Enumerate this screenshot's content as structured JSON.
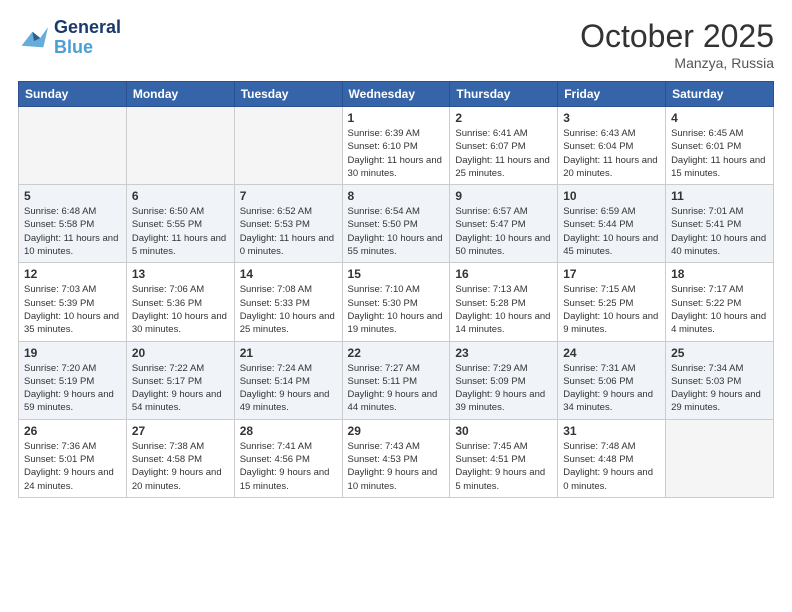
{
  "header": {
    "logo_line1": "General",
    "logo_line2": "Blue",
    "month": "October 2025",
    "location": "Manzya, Russia"
  },
  "weekdays": [
    "Sunday",
    "Monday",
    "Tuesday",
    "Wednesday",
    "Thursday",
    "Friday",
    "Saturday"
  ],
  "weeks": [
    [
      {
        "day": "",
        "info": ""
      },
      {
        "day": "",
        "info": ""
      },
      {
        "day": "",
        "info": ""
      },
      {
        "day": "1",
        "info": "Sunrise: 6:39 AM\nSunset: 6:10 PM\nDaylight: 11 hours\nand 30 minutes."
      },
      {
        "day": "2",
        "info": "Sunrise: 6:41 AM\nSunset: 6:07 PM\nDaylight: 11 hours\nand 25 minutes."
      },
      {
        "day": "3",
        "info": "Sunrise: 6:43 AM\nSunset: 6:04 PM\nDaylight: 11 hours\nand 20 minutes."
      },
      {
        "day": "4",
        "info": "Sunrise: 6:45 AM\nSunset: 6:01 PM\nDaylight: 11 hours\nand 15 minutes."
      }
    ],
    [
      {
        "day": "5",
        "info": "Sunrise: 6:48 AM\nSunset: 5:58 PM\nDaylight: 11 hours\nand 10 minutes."
      },
      {
        "day": "6",
        "info": "Sunrise: 6:50 AM\nSunset: 5:55 PM\nDaylight: 11 hours\nand 5 minutes."
      },
      {
        "day": "7",
        "info": "Sunrise: 6:52 AM\nSunset: 5:53 PM\nDaylight: 11 hours\nand 0 minutes."
      },
      {
        "day": "8",
        "info": "Sunrise: 6:54 AM\nSunset: 5:50 PM\nDaylight: 10 hours\nand 55 minutes."
      },
      {
        "day": "9",
        "info": "Sunrise: 6:57 AM\nSunset: 5:47 PM\nDaylight: 10 hours\nand 50 minutes."
      },
      {
        "day": "10",
        "info": "Sunrise: 6:59 AM\nSunset: 5:44 PM\nDaylight: 10 hours\nand 45 minutes."
      },
      {
        "day": "11",
        "info": "Sunrise: 7:01 AM\nSunset: 5:41 PM\nDaylight: 10 hours\nand 40 minutes."
      }
    ],
    [
      {
        "day": "12",
        "info": "Sunrise: 7:03 AM\nSunset: 5:39 PM\nDaylight: 10 hours\nand 35 minutes."
      },
      {
        "day": "13",
        "info": "Sunrise: 7:06 AM\nSunset: 5:36 PM\nDaylight: 10 hours\nand 30 minutes."
      },
      {
        "day": "14",
        "info": "Sunrise: 7:08 AM\nSunset: 5:33 PM\nDaylight: 10 hours\nand 25 minutes."
      },
      {
        "day": "15",
        "info": "Sunrise: 7:10 AM\nSunset: 5:30 PM\nDaylight: 10 hours\nand 19 minutes."
      },
      {
        "day": "16",
        "info": "Sunrise: 7:13 AM\nSunset: 5:28 PM\nDaylight: 10 hours\nand 14 minutes."
      },
      {
        "day": "17",
        "info": "Sunrise: 7:15 AM\nSunset: 5:25 PM\nDaylight: 10 hours\nand 9 minutes."
      },
      {
        "day": "18",
        "info": "Sunrise: 7:17 AM\nSunset: 5:22 PM\nDaylight: 10 hours\nand 4 minutes."
      }
    ],
    [
      {
        "day": "19",
        "info": "Sunrise: 7:20 AM\nSunset: 5:19 PM\nDaylight: 9 hours\nand 59 minutes."
      },
      {
        "day": "20",
        "info": "Sunrise: 7:22 AM\nSunset: 5:17 PM\nDaylight: 9 hours\nand 54 minutes."
      },
      {
        "day": "21",
        "info": "Sunrise: 7:24 AM\nSunset: 5:14 PM\nDaylight: 9 hours\nand 49 minutes."
      },
      {
        "day": "22",
        "info": "Sunrise: 7:27 AM\nSunset: 5:11 PM\nDaylight: 9 hours\nand 44 minutes."
      },
      {
        "day": "23",
        "info": "Sunrise: 7:29 AM\nSunset: 5:09 PM\nDaylight: 9 hours\nand 39 minutes."
      },
      {
        "day": "24",
        "info": "Sunrise: 7:31 AM\nSunset: 5:06 PM\nDaylight: 9 hours\nand 34 minutes."
      },
      {
        "day": "25",
        "info": "Sunrise: 7:34 AM\nSunset: 5:03 PM\nDaylight: 9 hours\nand 29 minutes."
      }
    ],
    [
      {
        "day": "26",
        "info": "Sunrise: 7:36 AM\nSunset: 5:01 PM\nDaylight: 9 hours\nand 24 minutes."
      },
      {
        "day": "27",
        "info": "Sunrise: 7:38 AM\nSunset: 4:58 PM\nDaylight: 9 hours\nand 20 minutes."
      },
      {
        "day": "28",
        "info": "Sunrise: 7:41 AM\nSunset: 4:56 PM\nDaylight: 9 hours\nand 15 minutes."
      },
      {
        "day": "29",
        "info": "Sunrise: 7:43 AM\nSunset: 4:53 PM\nDaylight: 9 hours\nand 10 minutes."
      },
      {
        "day": "30",
        "info": "Sunrise: 7:45 AM\nSunset: 4:51 PM\nDaylight: 9 hours\nand 5 minutes."
      },
      {
        "day": "31",
        "info": "Sunrise: 7:48 AM\nSunset: 4:48 PM\nDaylight: 9 hours\nand 0 minutes."
      },
      {
        "day": "",
        "info": ""
      }
    ]
  ]
}
